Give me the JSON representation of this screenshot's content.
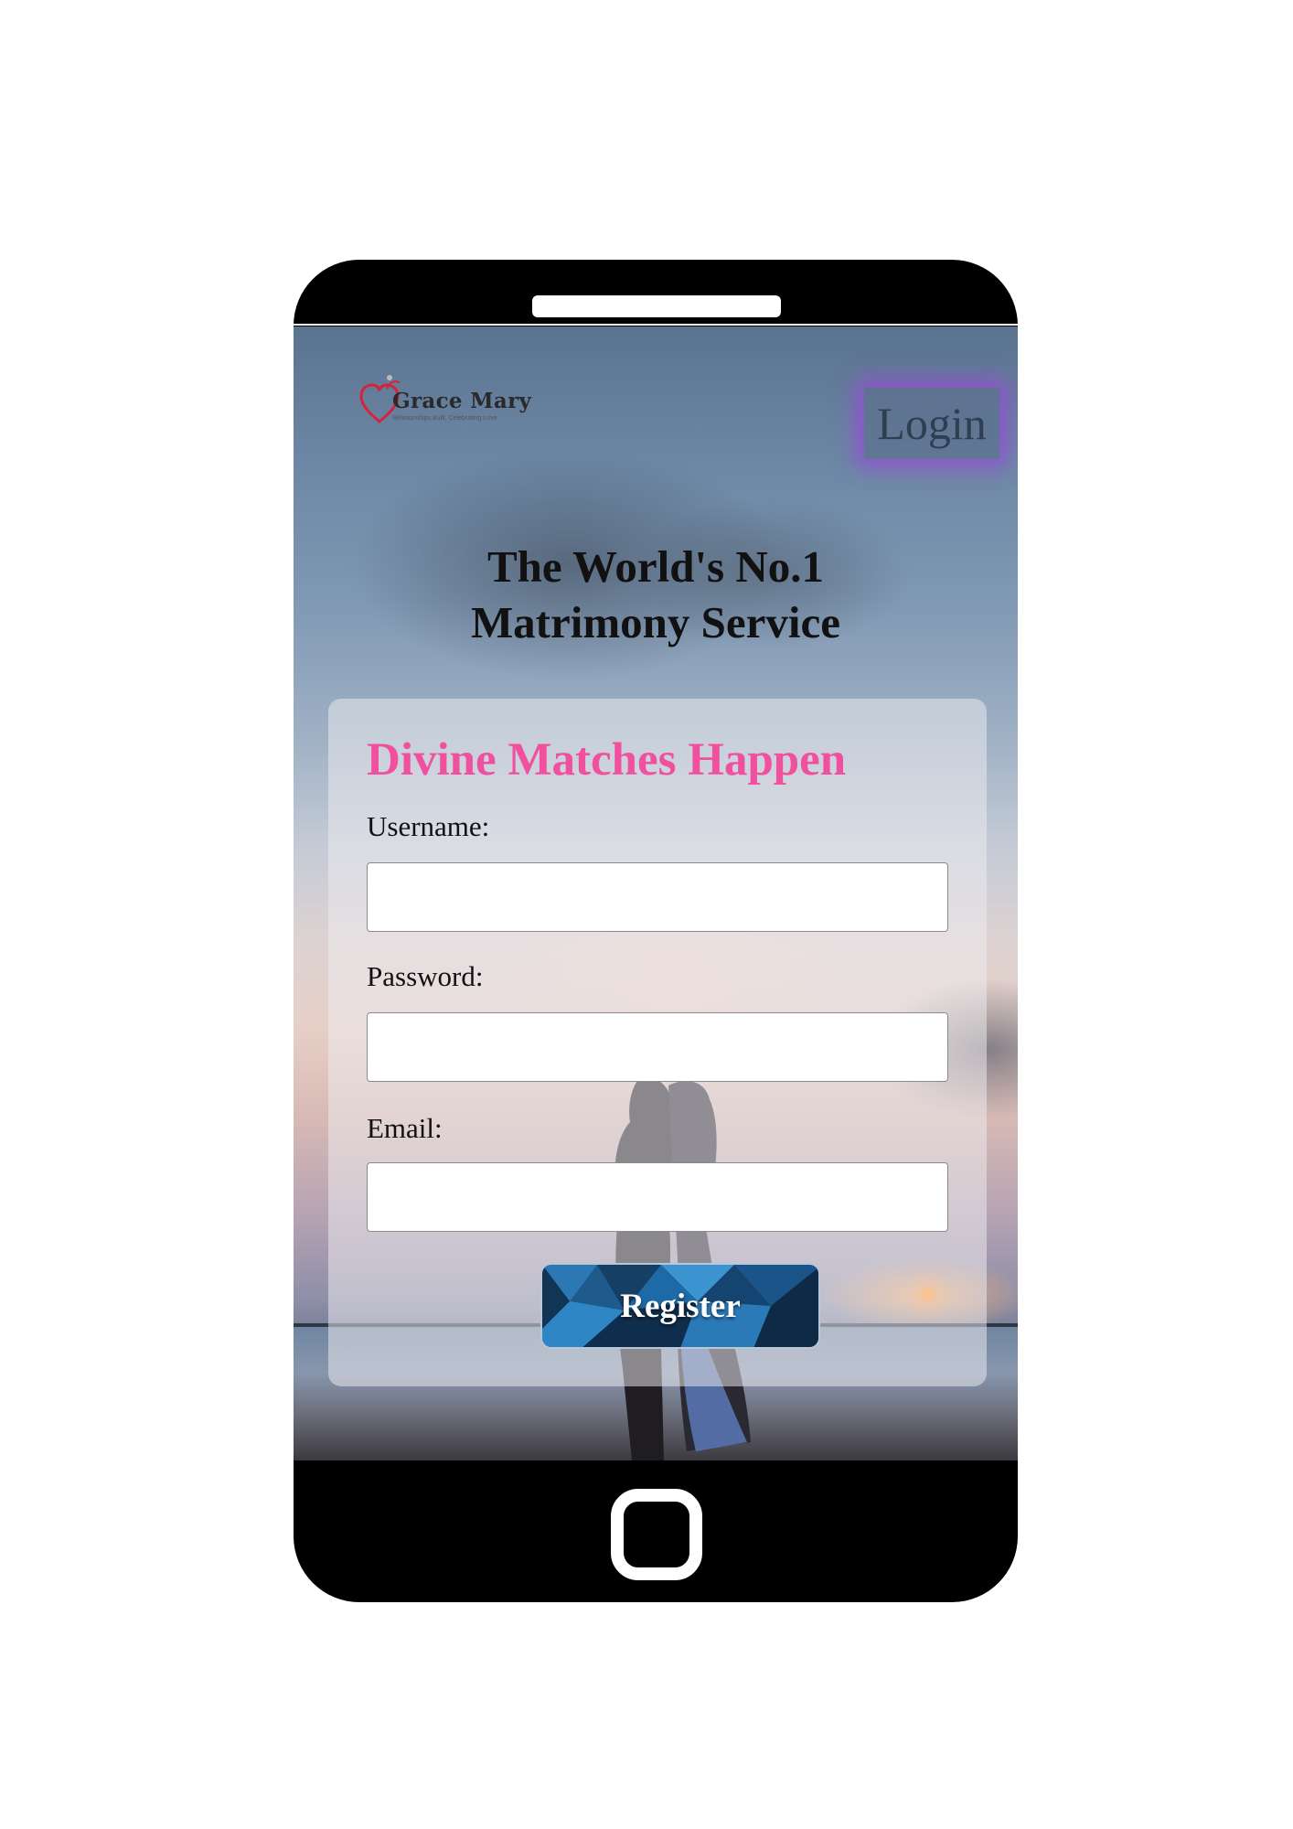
{
  "logo": {
    "name": "Grace Mary",
    "tagline": "Relationships Built, Celebrating Love"
  },
  "header": {
    "login_label": "Login"
  },
  "hero": {
    "title_line1": "The World's No.1",
    "title_line2": "Matrimony Service"
  },
  "form": {
    "title": "Divine Matches Happen",
    "fields": [
      {
        "label": "Username:",
        "value": ""
      },
      {
        "label": "Password:",
        "value": ""
      },
      {
        "label": "Email:",
        "value": ""
      }
    ],
    "submit_label": "Register"
  },
  "colors": {
    "accent_pink": "#f0509e",
    "login_glow": "#9b46dc",
    "phone_frame": "#000000",
    "register_button": "#2a6aa0"
  },
  "icons": [
    "heart-logo-icon",
    "home-button-icon"
  ]
}
